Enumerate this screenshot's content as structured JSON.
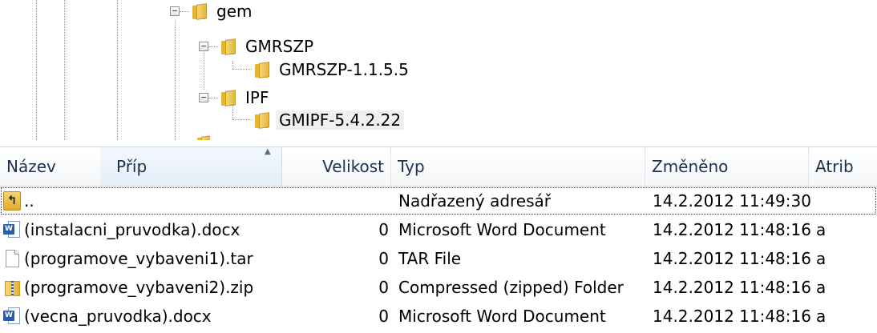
{
  "tree": {
    "nodes": [
      {
        "label": "gem",
        "expanded": true
      },
      {
        "label": "GMRSZP",
        "expanded": true
      },
      {
        "label": "GMRSZP-1.1.5.5"
      },
      {
        "label": "IPF",
        "expanded": true
      },
      {
        "label": "GMIPF-5.4.2.22",
        "selected": true
      }
    ],
    "expander_glyph": "−"
  },
  "list": {
    "columns": {
      "name": "Název",
      "ext": "Příp",
      "size": "Velikost",
      "type": "Typ",
      "modified": "Změněno",
      "attr": "Atrib"
    },
    "rows": [
      {
        "icon": "up-folder-icon",
        "icon_glyph": "↰",
        "name": "..",
        "size": "",
        "type": "Nadřazený adresář",
        "modified": "14.2.2012 11:49:30",
        "attr": ""
      },
      {
        "icon": "word-document-icon",
        "icon_glyph": "W",
        "name": "(instalacni_pruvodka).docx",
        "size": "0",
        "type": "Microsoft Word Document",
        "modified": "14.2.2012 11:48:16",
        "attr": "a"
      },
      {
        "icon": "blank-file-icon",
        "icon_glyph": "",
        "name": "(programove_vybaveni1).tar",
        "size": "0",
        "type": "TAR File",
        "modified": "14.2.2012 11:48:16",
        "attr": "a"
      },
      {
        "icon": "zip-folder-icon",
        "icon_glyph": "",
        "name": "(programove_vybaveni2).zip",
        "size": "0",
        "type": "Compressed (zipped) Folder",
        "modified": "14.2.2012 11:48:16",
        "attr": "a"
      },
      {
        "icon": "word-document-icon",
        "icon_glyph": "W",
        "name": "(vecna_pruvodka).docx",
        "size": "0",
        "type": "Microsoft Word Document",
        "modified": "14.2.2012 11:48:16",
        "attr": "a"
      }
    ]
  },
  "colors": {
    "header_text": "#1e3050",
    "active_header": "#e3eef9",
    "folder": "#e8b62c",
    "selection": "#f0f0f0"
  }
}
